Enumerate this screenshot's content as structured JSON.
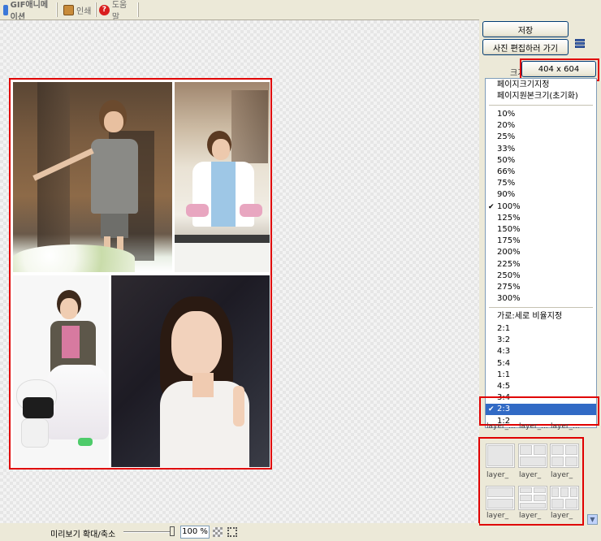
{
  "toolbar": {
    "gif_label": "GIF애니메이션",
    "print_label": "인쇄",
    "help_label": "도움말"
  },
  "right_panel": {
    "save_label": "저장",
    "edit_label": "사진 편집하러 가기",
    "size_label": "크기",
    "size_value": "404 x 604",
    "icon_names": [
      "menu-icon"
    ]
  },
  "dropdown": {
    "page_fit": "페이지크기지정",
    "page_original": "페이지원본크기(초기화)",
    "zoom_options": [
      "10%",
      "20%",
      "25%",
      "33%",
      "50%",
      "66%",
      "75%",
      "90%",
      "100%",
      "125%",
      "150%",
      "175%",
      "200%",
      "225%",
      "250%",
      "275%",
      "300%"
    ],
    "zoom_checked": "100%",
    "ratio_header": "가로:세로 비율지정",
    "ratio_options": [
      "2:1",
      "3:2",
      "4:3",
      "5:4",
      "1:1",
      "4:5",
      "3:4",
      "2:3",
      "1:2"
    ],
    "ratio_selected": "2:3"
  },
  "layouts": [
    {
      "label": "layer_"
    },
    {
      "label": "layer_"
    },
    {
      "label": "layer_"
    },
    {
      "label": "layer_"
    },
    {
      "label": "layer_"
    },
    {
      "label": "layer_"
    },
    {
      "label": "layer_..."
    },
    {
      "label": "layer_..."
    },
    {
      "label": "layer_..."
    }
  ],
  "statusbar": {
    "zoom_label": "미리보기 확대/축소",
    "zoom_value": "100 %"
  },
  "colors": {
    "highlight": "#e00000",
    "selection": "#316ac5",
    "panel": "#ece9d8"
  }
}
